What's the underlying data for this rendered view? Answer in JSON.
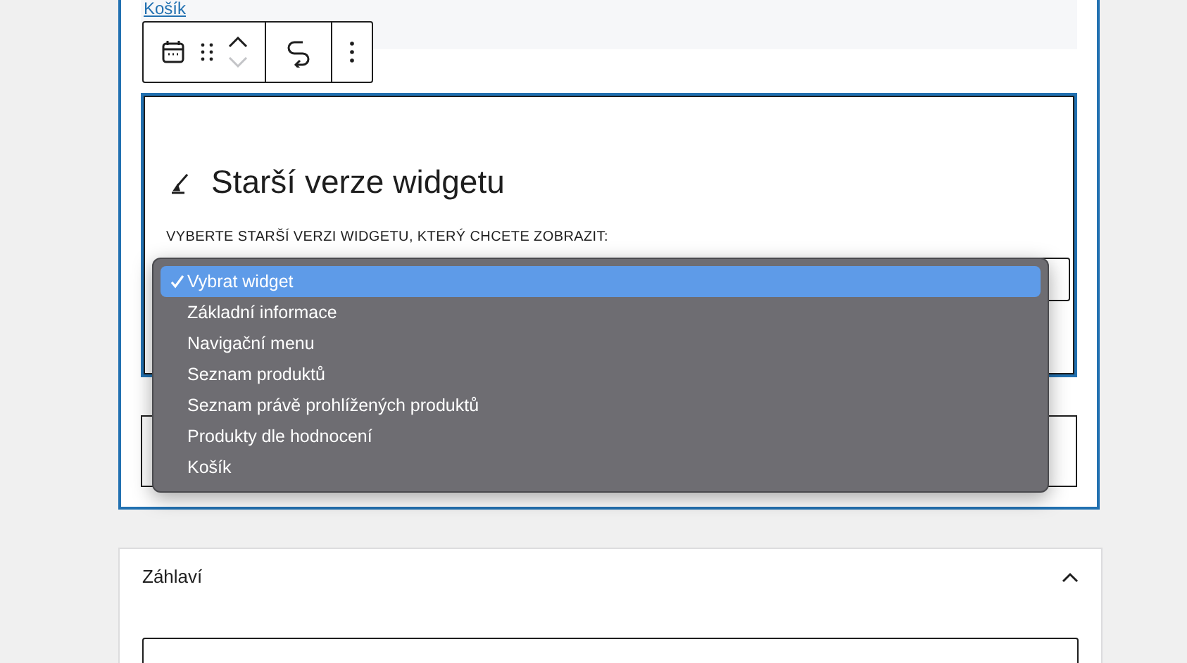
{
  "top_block": {
    "link": "Košík"
  },
  "legacy_widget": {
    "title": "Starší verze widgetu",
    "label": "VYBERTE STARŠÍ VERZI WIDGETU, KTERÝ CHCETE ZOBRAZIT:",
    "options": [
      {
        "label": "Vybrat widget",
        "selected": true
      },
      {
        "label": "Základní informace",
        "selected": false
      },
      {
        "label": "Navigační menu",
        "selected": false
      },
      {
        "label": "Seznam produktů",
        "selected": false
      },
      {
        "label": "Seznam právě prohlížených produktů",
        "selected": false
      },
      {
        "label": "Produkty dle hodnocení",
        "selected": false
      },
      {
        "label": "Košík",
        "selected": false
      }
    ]
  },
  "section": {
    "title": "Záhlaví",
    "expanded": true
  }
}
